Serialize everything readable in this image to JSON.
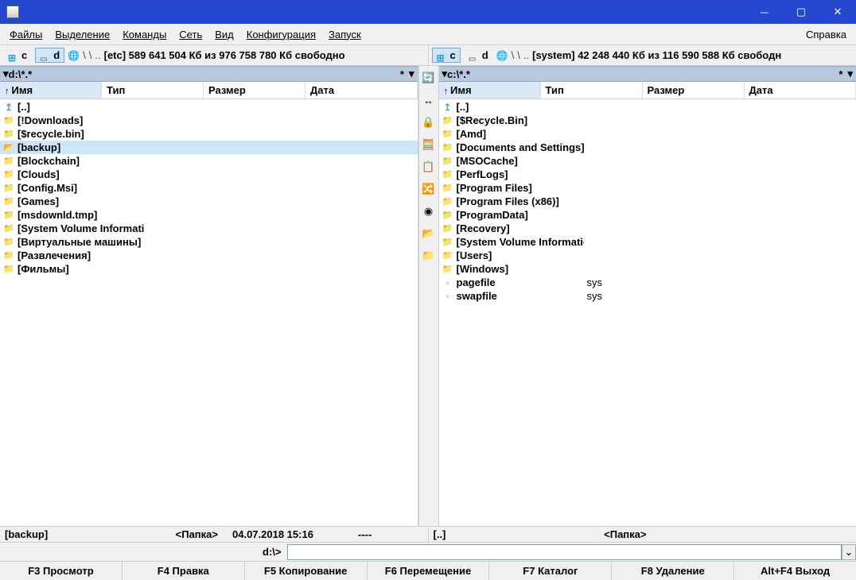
{
  "title": "",
  "menu": {
    "file": "Файлы",
    "select": "Выделение",
    "commands": "Команды",
    "net": "Сеть",
    "view": "Вид",
    "config": "Конфигурация",
    "start": "Запуск",
    "help": "Справка"
  },
  "drivebar_left": {
    "drives": [
      {
        "id": "c",
        "icon": "win"
      },
      {
        "id": "d",
        "icon": "hdd",
        "active": true
      }
    ],
    "label": "[etc]",
    "free": "589 641 504 Кб из 976 758 780 Кб свободно"
  },
  "drivebar_right": {
    "drives": [
      {
        "id": "c",
        "icon": "win",
        "active": true
      },
      {
        "id": "d",
        "icon": "hdd"
      }
    ],
    "label": "[system]",
    "free": "42 248 440 Кб из 116 590 588 Кб свободн"
  },
  "panel_left": {
    "path": "d:\\*.*",
    "cols": {
      "name": "Имя",
      "type": "Тип",
      "size": "Размер",
      "date": "Дата"
    },
    "items": [
      {
        "icon": "up",
        "name": "[..]"
      },
      {
        "icon": "folder",
        "name": "[!Downloads]"
      },
      {
        "icon": "folder-warn",
        "name": "[$recycle.bin]"
      },
      {
        "icon": "folder-open",
        "name": "[backup]",
        "selected": true
      },
      {
        "icon": "folder",
        "name": "[Blockchain]"
      },
      {
        "icon": "folder",
        "name": "[Clouds]"
      },
      {
        "icon": "folder-warn",
        "name": "[Config.Msi]"
      },
      {
        "icon": "folder",
        "name": "[Games]"
      },
      {
        "icon": "folder-warn",
        "name": "[msdownld.tmp]"
      },
      {
        "icon": "folder-warn",
        "name": "[System Volume Information]"
      },
      {
        "icon": "folder",
        "name": "[Виртуальные машины]"
      },
      {
        "icon": "folder",
        "name": "[Развлечения]"
      },
      {
        "icon": "folder",
        "name": "[Фильмы]"
      }
    ],
    "status": {
      "name": "[backup]",
      "type": "<Папка>",
      "date": "04.07.2018 15:16",
      "attr": "----"
    }
  },
  "panel_right": {
    "path": "c:\\*.*",
    "cols": {
      "name": "Имя",
      "type": "Тип",
      "size": "Размер",
      "date": "Дата"
    },
    "items": [
      {
        "icon": "up",
        "name": "[..]"
      },
      {
        "icon": "folder-warn",
        "name": "[$Recycle.Bin]"
      },
      {
        "icon": "folder",
        "name": "[Amd]"
      },
      {
        "icon": "folder-warn",
        "name": "[Documents and Settings]"
      },
      {
        "icon": "folder-warn",
        "name": "[MSOCache]"
      },
      {
        "icon": "folder",
        "name": "[PerfLogs]"
      },
      {
        "icon": "folder",
        "name": "[Program Files]"
      },
      {
        "icon": "folder",
        "name": "[Program Files (x86)]"
      },
      {
        "icon": "folder-warn",
        "name": "[ProgramData]"
      },
      {
        "icon": "folder-warn",
        "name": "[Recovery]"
      },
      {
        "icon": "folder-warn",
        "name": "[System Volume Information]"
      },
      {
        "icon": "folder",
        "name": "[Users]"
      },
      {
        "icon": "folder",
        "name": "[Windows]"
      },
      {
        "icon": "file",
        "name": "pagefile",
        "type": "sys"
      },
      {
        "icon": "file",
        "name": "swapfile",
        "type": "sys"
      }
    ],
    "status": {
      "name": "[..]",
      "type": "<Папка>",
      "date": "",
      "attr": ""
    }
  },
  "cmdline": {
    "prompt": "d:\\>"
  },
  "fkeys": [
    {
      "k": "F3 Просмотр"
    },
    {
      "k": "F4 Правка"
    },
    {
      "k": "F5 Копирование"
    },
    {
      "k": "F6 Перемещение"
    },
    {
      "k": "F7 Каталог"
    },
    {
      "k": "F8 Удаление"
    },
    {
      "k": "Alt+F4 Выход"
    }
  ],
  "midbar": [
    "🔄",
    "↔",
    "🔒",
    "🧮",
    "📋",
    "🔀",
    "◉",
    "📂",
    "📁"
  ]
}
